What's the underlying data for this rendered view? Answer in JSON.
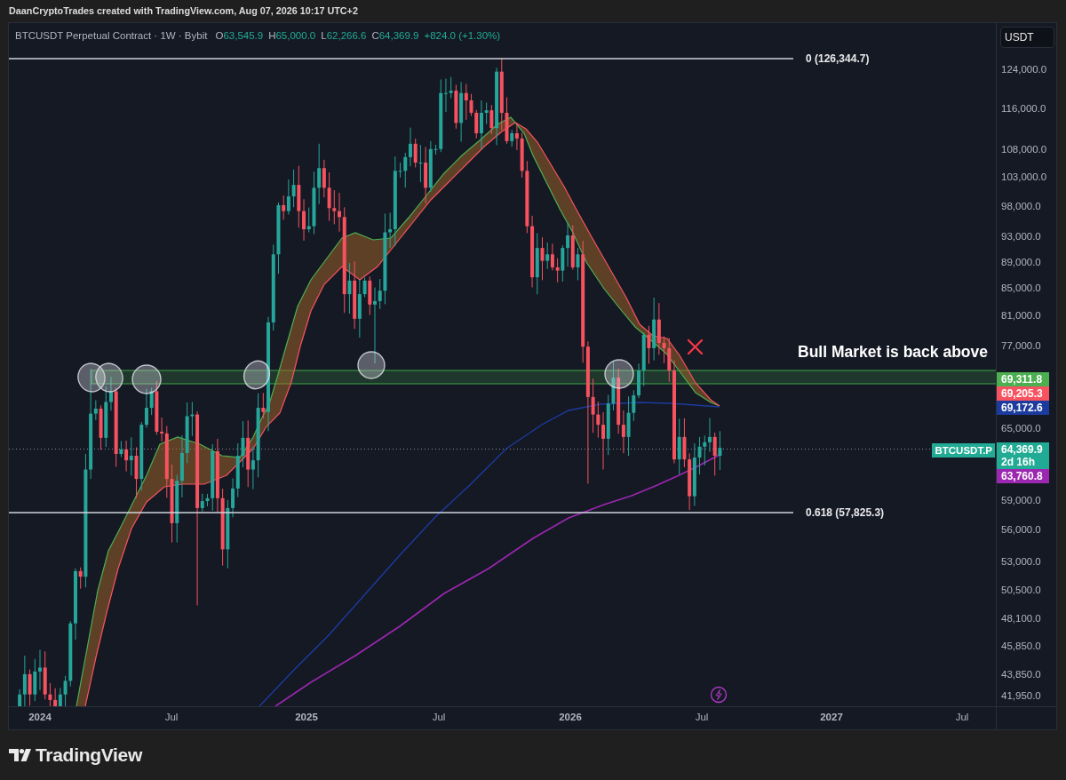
{
  "header": {
    "caption": "DaanCryptoTrades created with TradingView.com, Aug 07, 2026 10:17 UTC+2"
  },
  "legend": {
    "symbol": "BTCUSDT Perpetual Contract · 1W · Bybit",
    "ohlc": [
      {
        "label": "O",
        "value": "63,545.9"
      },
      {
        "label": "H",
        "value": "65,000.0"
      },
      {
        "label": "L",
        "value": "62,266.6"
      },
      {
        "label": "C",
        "value": "64,369.9"
      }
    ],
    "change": "+824.0 (+1.30%)"
  },
  "chart": {
    "fib_levels": [
      {
        "label": "0 (126,344.7)"
      },
      {
        "label": "0.618 (57,825.3)"
      }
    ],
    "annotation": "Bull Market is back above",
    "symbol_tag": "BTCUSDT.P"
  },
  "price_axis": {
    "currency_button": "USDT",
    "ticks": [
      "124,000.0",
      "116,000.0",
      "108,000.0",
      "103,000.0",
      "98,000.0",
      "93,000.0",
      "89,000.0",
      "85,000.0",
      "81,000.0",
      "77,000.0",
      "65,000.0",
      "59,000.0",
      "56,000.0",
      "53,000.0",
      "50,500.0",
      "48,100.0",
      "45,850.0",
      "43,850.0",
      "41,950.0"
    ],
    "tags": [
      {
        "value": "69,311.8",
        "color": "#4caf50"
      },
      {
        "value": "69,205.3",
        "color": "#f7525f"
      },
      {
        "value": "69,172.6",
        "color": "#1c3b9e"
      },
      {
        "value": "64,369.9",
        "countdown": "2d 16h",
        "color": "#22ab94"
      },
      {
        "value": "63,760.8",
        "color": "#9c27b0"
      }
    ]
  },
  "time_axis": {
    "ticks": [
      {
        "text": "2024",
        "kind": "year"
      },
      {
        "text": "Jul",
        "kind": "month"
      },
      {
        "text": "2025",
        "kind": "year"
      },
      {
        "text": "Jul",
        "kind": "month"
      },
      {
        "text": "2026",
        "kind": "year"
      },
      {
        "text": "Jul",
        "kind": "month"
      },
      {
        "text": "2027",
        "kind": "year"
      },
      {
        "text": "Jul",
        "kind": "month"
      }
    ]
  },
  "footer": {
    "brand": "TradingView"
  }
}
